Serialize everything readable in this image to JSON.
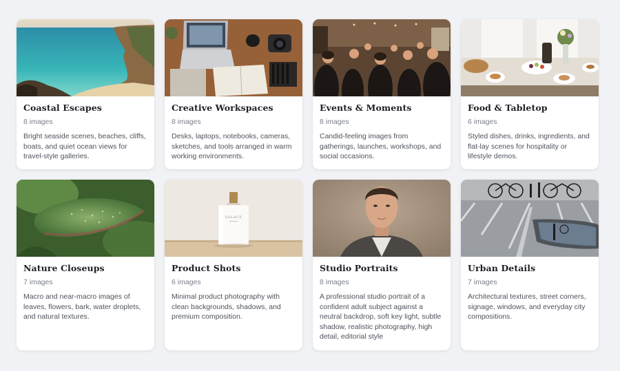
{
  "collections": [
    {
      "title": "Coastal Escapes",
      "count": "8 images",
      "description": "Bright seaside scenes, beaches, cliffs, boats, and quiet ocean views for travel-style galleries.",
      "thumbnail": "coastal-cliff-beach-photo"
    },
    {
      "title": "Creative Workspaces",
      "count": "8 images",
      "description": "Desks, laptops, notebooks, cameras, sketches, and tools arranged in warm working environments.",
      "thumbnail": "desk-laptop-camera-photo"
    },
    {
      "title": "Events & Moments",
      "count": "8 images",
      "description": "Candid-feeling images from gatherings, launches, workshops, and social occasions.",
      "thumbnail": "crowd-gathering-photo"
    },
    {
      "title": "Food & Tabletop",
      "count": "6 images",
      "description": "Styled dishes, drinks, ingredients, and flat-lay scenes for hospitality or lifestyle demos.",
      "thumbnail": "breakfast-table-photo"
    },
    {
      "title": "Nature Closeups",
      "count": "7 images",
      "description": "Macro and near-macro images of leaves, flowers, bark, water droplets, and natural textures.",
      "thumbnail": "succulent-leaf-macro-photo"
    },
    {
      "title": "Product Shots",
      "count": "6 images",
      "description": "Minimal product photography with clean backgrounds, shadows, and premium composition.",
      "thumbnail": "perfume-bottle-photo",
      "product_label": "SOLACE"
    },
    {
      "title": "Studio Portraits",
      "count": "8 images",
      "description": "A professional studio portrait of a confident adult subject against a neutral backdrop, soft key light, subtle shadow, realistic photography, high detail, editorial style",
      "thumbnail": "man-studio-portrait-photo"
    },
    {
      "title": "Urban Details",
      "count": "7 images",
      "description": "Architectural textures, street corners, signage, windows, and everyday city compositions.",
      "thumbnail": "street-puddle-bicycles-photo"
    }
  ]
}
